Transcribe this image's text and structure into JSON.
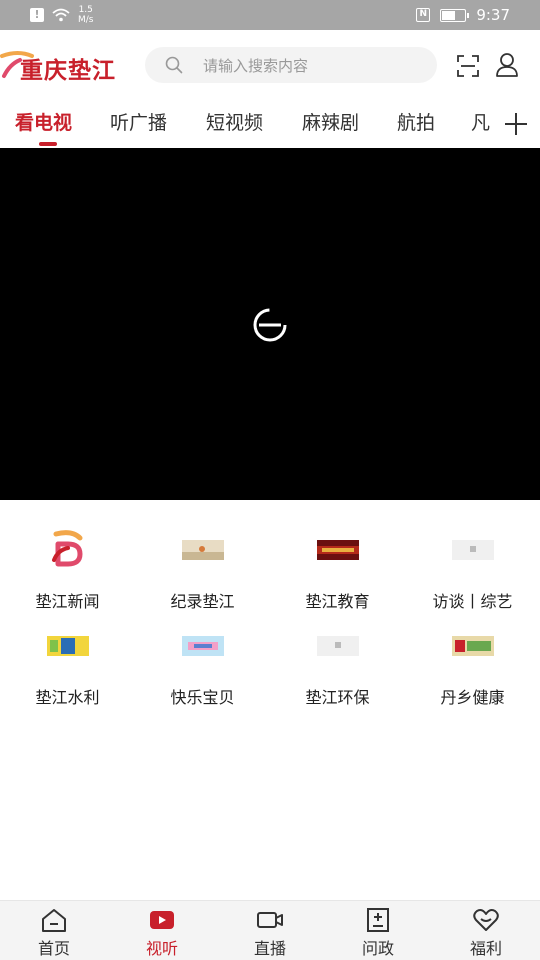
{
  "status_bar": {
    "network_speed_value": "1.5",
    "network_speed_unit": "M/s",
    "nfc_label": "N",
    "battery_level_percent": 60,
    "time": "9:37"
  },
  "header": {
    "logo_text": "重庆垫江",
    "search_placeholder": "请输入搜索内容"
  },
  "tabs": [
    {
      "label": "看电视",
      "active": true
    },
    {
      "label": "听广播",
      "active": false
    },
    {
      "label": "短视频",
      "active": false
    },
    {
      "label": "麻辣剧",
      "active": false
    },
    {
      "label": "航拍",
      "active": false
    },
    {
      "label": "凡",
      "active": false
    }
  ],
  "channels": [
    {
      "label": "垫江新闻",
      "icon": "app-logo-icon"
    },
    {
      "label": "纪录垫江",
      "icon": "documentary-thumbnail"
    },
    {
      "label": "垫江教育",
      "icon": "education-thumbnail"
    },
    {
      "label": "访谈丨综艺",
      "icon": "interview-thumbnail"
    },
    {
      "label": "垫江水利",
      "icon": "water-conservancy-thumbnail"
    },
    {
      "label": "快乐宝贝",
      "icon": "happy-baby-thumbnail"
    },
    {
      "label": "垫江环保",
      "icon": "environment-thumbnail"
    },
    {
      "label": "丹乡健康",
      "icon": "health-thumbnail"
    }
  ],
  "bottom_nav": [
    {
      "label": "首页",
      "icon": "home-icon",
      "active": false
    },
    {
      "label": "视听",
      "icon": "video-play-icon",
      "active": true
    },
    {
      "label": "直播",
      "icon": "camera-icon",
      "active": false
    },
    {
      "label": "问政",
      "icon": "document-icon",
      "active": false
    },
    {
      "label": "福利",
      "icon": "heart-icon",
      "active": false
    }
  ],
  "colors": {
    "accent": "#c8202b",
    "status_bar": "#a6a6a6",
    "player_background": "#000000"
  }
}
